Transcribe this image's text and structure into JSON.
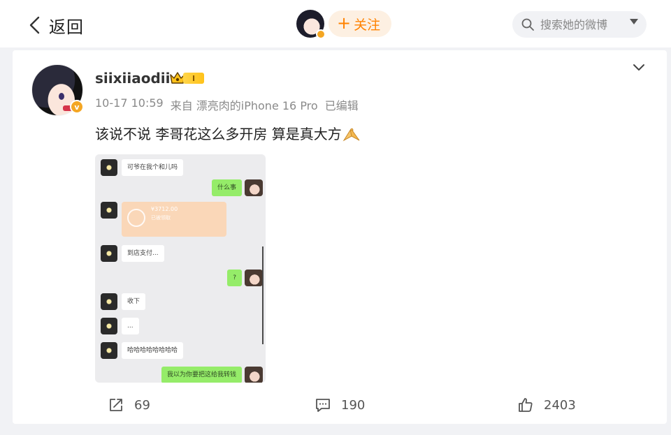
{
  "header": {
    "back_label": "返回",
    "follow_label": "关注",
    "follow_plus": "+",
    "search_placeholder": "搜索她的微博"
  },
  "post": {
    "username": "siixiiaodii",
    "vip_level": "I",
    "timestamp": "10-17 10:59",
    "source": "来自 漂亮肉的iPhone 16 Pro",
    "edited": "已编辑",
    "text": "该说不说 李哥花这么多开房 算是真大方"
  },
  "chat": {
    "messages": [
      {
        "side": "left",
        "text": "可爷在我个和儿吗"
      },
      {
        "side": "right",
        "text": "什么事"
      },
      {
        "side": "left",
        "type": "transfer",
        "amount": "¥3712.00",
        "note": "已被领取"
      },
      {
        "side": "left",
        "text": "到店支付..."
      },
      {
        "side": "right",
        "text": "?"
      },
      {
        "side": "left",
        "text": "收下"
      },
      {
        "side": "left",
        "text": "..."
      },
      {
        "side": "left",
        "text": "哈哈哈哈哈哈哈哈"
      },
      {
        "side": "right",
        "text": "我以为你要把这给我转钱"
      }
    ]
  },
  "actions": {
    "repost_count": "69",
    "comment_count": "190",
    "like_count": "2403"
  },
  "colors": {
    "accent": "#ff8200",
    "vip_gold": "#ffc21a",
    "verified": "#f4a623",
    "wechat_green": "#95ec69"
  },
  "icons": {
    "back": "chevron-left-icon",
    "search": "search-icon",
    "dropdown": "caret-down-icon",
    "more": "chevron-down-icon",
    "repost": "share-icon",
    "comment": "comment-icon",
    "like": "thumbs-up-icon"
  }
}
